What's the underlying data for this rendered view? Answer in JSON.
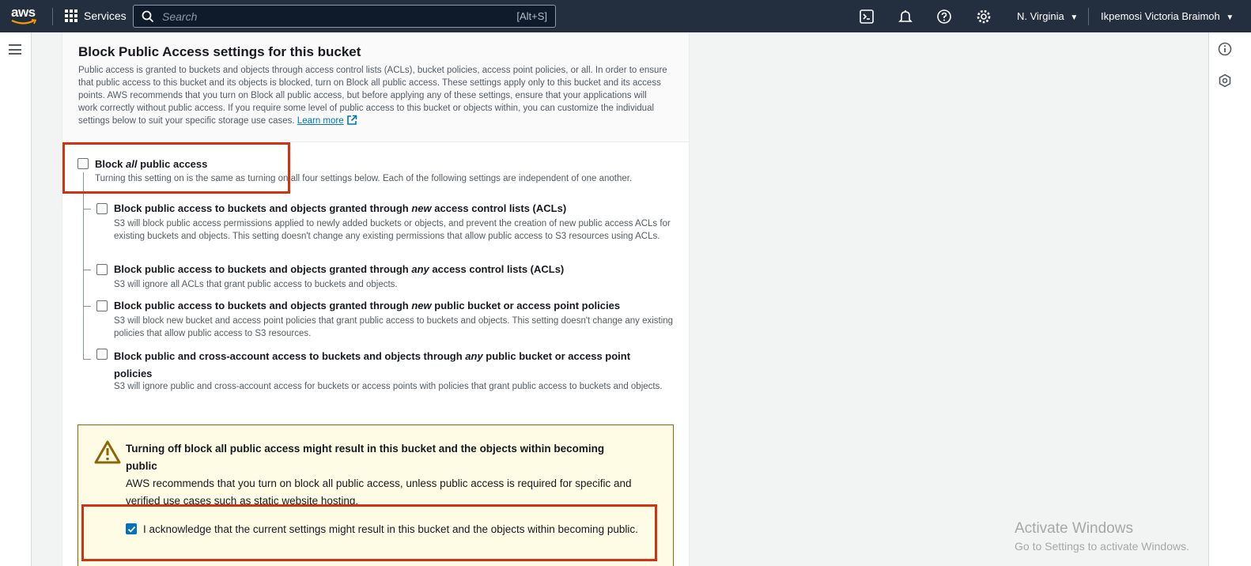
{
  "topnav": {
    "logo_text": "aws",
    "services_label": "Services",
    "search_placeholder": "Search",
    "search_shortcut": "[Alt+S]",
    "region": "N. Virginia",
    "user": "Ikpemosi Victoria Braimoh",
    "icons": [
      "cloudshell-icon",
      "notifications-icon",
      "help-icon",
      "settings-icon"
    ]
  },
  "panel": {
    "title": "Block Public Access settings for this bucket",
    "description": "Public access is granted to buckets and objects through access control lists (ACLs), bucket policies, access point policies, or all. In order to ensure that public access to this bucket and its objects is blocked, turn on Block all public access. These settings apply only to this bucket and its access points. AWS recommends that you turn on Block all public access, but before applying any of these settings, ensure that your applications will work correctly without public access. If you require some level of public access to this bucket or objects within, you can customize the individual settings below to suit your specific storage use cases.",
    "learn_more": "Learn more"
  },
  "block_all": {
    "label_prefix": "Block ",
    "label_em": "all",
    "label_suffix": " public access",
    "description": "Turning this setting on is the same as turning on all four settings below. Each of the following settings are independent of one another.",
    "checked": false
  },
  "options": [
    {
      "label_prefix": "Block public access to buckets and objects granted through ",
      "label_em": "new",
      "label_suffix": " access control lists (ACLs)",
      "description": "S3 will block public access permissions applied to newly added buckets or objects, and prevent the creation of new public access ACLs for existing buckets and objects. This setting doesn't change any existing permissions that allow public access to S3 resources using ACLs.",
      "checked": false
    },
    {
      "label_prefix": "Block public access to buckets and objects granted through ",
      "label_em": "any",
      "label_suffix": " access control lists (ACLs)",
      "description": "S3 will ignore all ACLs that grant public access to buckets and objects.",
      "checked": false
    },
    {
      "label_prefix": "Block public access to buckets and objects granted through ",
      "label_em": "new",
      "label_suffix": " public bucket or access point policies",
      "description": "S3 will block new bucket and access point policies that grant public access to buckets and objects. This setting doesn't change any existing policies that allow public access to S3 resources.",
      "checked": false
    },
    {
      "label_prefix": "Block public and cross-account access to buckets and objects through ",
      "label_em": "any",
      "label_suffix": " public bucket or access point policies",
      "description": "S3 will ignore public and cross-account access for buckets or access points with policies that grant public access to buckets and objects.",
      "checked": false
    }
  ],
  "alert": {
    "title": "Turning off block all public access might result in this bucket and the objects within becoming public",
    "body": "AWS recommends that you turn on block all public access, unless public access is required for specific and verified use cases such as static website hosting.",
    "ack_label": "I acknowledge that the current settings might result in this bucket and the objects within becoming public.",
    "ack_checked": true
  },
  "watermark": {
    "line1": "Activate Windows",
    "line2": "Go to Settings to activate Windows."
  },
  "colors": {
    "nav_bg": "#232f3e",
    "link": "#0073bb",
    "highlight_box": "#d13212",
    "warning_bg": "#fffce6"
  }
}
